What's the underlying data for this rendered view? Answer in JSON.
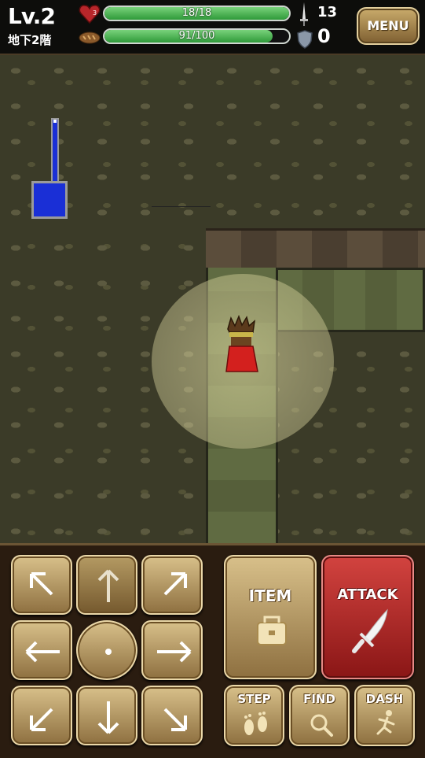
{
  "hud": {
    "level": "Lv.2",
    "floor": "地下2階",
    "hp": {
      "text": "18/18",
      "current": 18,
      "max": 18
    },
    "food": {
      "text": "91/100",
      "current": 91,
      "max": 100
    },
    "hunger_badge": "3",
    "attack": "13",
    "defense": "0",
    "menu_label": "MENU"
  },
  "controls": {
    "item_label": "ITEM",
    "attack_label": "ATTACK",
    "step_label": "STEP",
    "find_label": "FIND",
    "dash_label": "DASH"
  },
  "icons": [
    "heart-icon",
    "bread-icon",
    "sword-icon",
    "shield-icon",
    "bag-icon",
    "dagger-icon",
    "footprints-icon",
    "magnifier-icon",
    "runner-icon"
  ],
  "colors": {
    "hp_fill": "#4cb84f",
    "attack_button": "#c23434",
    "minimap": "#1a2fd6"
  }
}
